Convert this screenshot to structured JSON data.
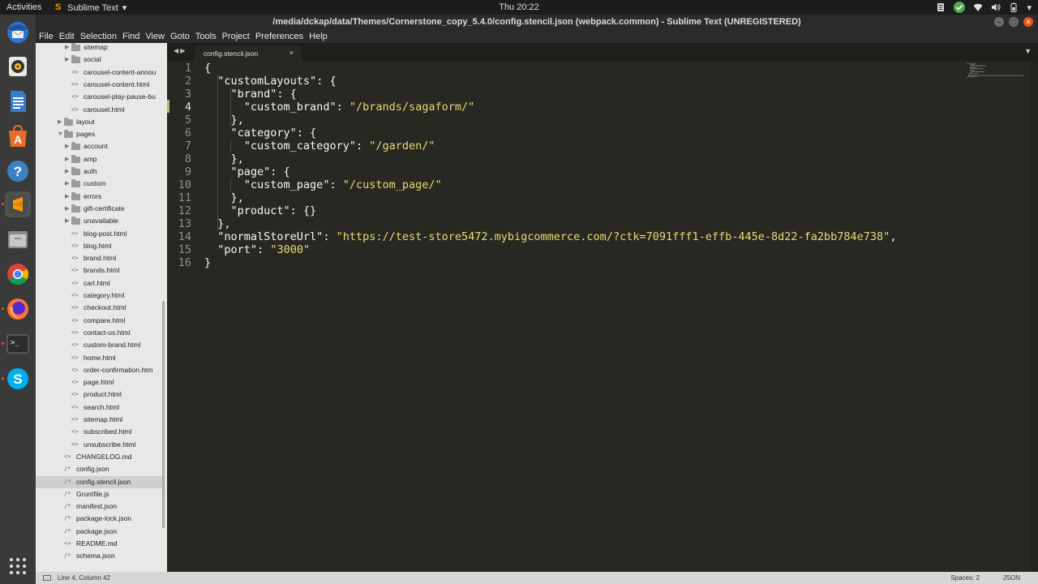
{
  "topbar": {
    "activities": "Activities",
    "app_name": "Sublime Text",
    "app_menu_arrow": "▾",
    "clock": "Thu 20:22"
  },
  "window": {
    "title": "/media/dckap/data/Themes/Cornerstone_copy_5.4.0/config.stencil.json (webpack.common) - Sublime Text (UNREGISTERED)"
  },
  "menu": [
    "File",
    "Edit",
    "Selection",
    "Find",
    "View",
    "Goto",
    "Tools",
    "Project",
    "Preferences",
    "Help"
  ],
  "dock": {
    "items": [
      "thunderbird-icon",
      "rhythmbox-icon",
      "writer-icon",
      "software-center-icon",
      "help-icon",
      "sublime-text-icon",
      "files-icon",
      "chrome-icon",
      "firefox-icon",
      "terminal-icon",
      "skype-icon"
    ],
    "show_apps": "show-applications-icon"
  },
  "sidebar": {
    "rows": [
      {
        "label": "sitemap",
        "kind": "folder",
        "depth": 2
      },
      {
        "label": "social",
        "kind": "folder",
        "depth": 2
      },
      {
        "label": "carousel-content-annou",
        "kind": "file",
        "depth": 2,
        "icon": "<>"
      },
      {
        "label": "carousel-content.html",
        "kind": "file",
        "depth": 2,
        "icon": "<>"
      },
      {
        "label": "carousel-play-pause-bu",
        "kind": "file",
        "depth": 2,
        "icon": "<>"
      },
      {
        "label": "carousel.html",
        "kind": "file",
        "depth": 2,
        "icon": "<>"
      },
      {
        "label": "layout",
        "kind": "folder",
        "depth": 1
      },
      {
        "label": "pages",
        "kind": "folder-open",
        "depth": 1
      },
      {
        "label": "account",
        "kind": "folder",
        "depth": 2
      },
      {
        "label": "amp",
        "kind": "folder",
        "depth": 2
      },
      {
        "label": "auth",
        "kind": "folder",
        "depth": 2
      },
      {
        "label": "custom",
        "kind": "folder",
        "depth": 2
      },
      {
        "label": "errors",
        "kind": "folder",
        "depth": 2
      },
      {
        "label": "gift-certificate",
        "kind": "folder",
        "depth": 2
      },
      {
        "label": "unavailable",
        "kind": "folder",
        "depth": 2
      },
      {
        "label": "blog-post.html",
        "kind": "file",
        "depth": 2,
        "icon": "<>"
      },
      {
        "label": "blog.html",
        "kind": "file",
        "depth": 2,
        "icon": "<>"
      },
      {
        "label": "brand.html",
        "kind": "file",
        "depth": 2,
        "icon": "<>"
      },
      {
        "label": "brands.html",
        "kind": "file",
        "depth": 2,
        "icon": "<>"
      },
      {
        "label": "cart.html",
        "kind": "file",
        "depth": 2,
        "icon": "<>"
      },
      {
        "label": "category.html",
        "kind": "file",
        "depth": 2,
        "icon": "<>"
      },
      {
        "label": "checkout.html",
        "kind": "file",
        "depth": 2,
        "icon": "<>"
      },
      {
        "label": "compare.html",
        "kind": "file",
        "depth": 2,
        "icon": "<>"
      },
      {
        "label": "contact-us.html",
        "kind": "file",
        "depth": 2,
        "icon": "<>"
      },
      {
        "label": "custom-brand.html",
        "kind": "file",
        "depth": 2,
        "icon": "<>"
      },
      {
        "label": "home.html",
        "kind": "file",
        "depth": 2,
        "icon": "<>"
      },
      {
        "label": "order-confirmation.htm",
        "kind": "file",
        "depth": 2,
        "icon": "<>"
      },
      {
        "label": "page.html",
        "kind": "file",
        "depth": 2,
        "icon": "<>"
      },
      {
        "label": "product.html",
        "kind": "file",
        "depth": 2,
        "icon": "<>"
      },
      {
        "label": "search.html",
        "kind": "file",
        "depth": 2,
        "icon": "<>"
      },
      {
        "label": "sitemap.html",
        "kind": "file",
        "depth": 2,
        "icon": "<>"
      },
      {
        "label": "subscribed.html",
        "kind": "file",
        "depth": 2,
        "icon": "<>"
      },
      {
        "label": "unsubscribe.html",
        "kind": "file",
        "depth": 2,
        "icon": "<>"
      },
      {
        "label": "CHANGELOG.md",
        "kind": "file",
        "depth": 1,
        "icon": "<>"
      },
      {
        "label": "config.json",
        "kind": "file",
        "depth": 1,
        "icon": "/*"
      },
      {
        "label": "config.stencil.json",
        "kind": "file",
        "depth": 1,
        "icon": "/*",
        "selected": true
      },
      {
        "label": "Gruntfile.js",
        "kind": "file",
        "depth": 1,
        "icon": "/*"
      },
      {
        "label": "manifest.json",
        "kind": "file",
        "depth": 1,
        "icon": "/*"
      },
      {
        "label": "package-lock.json",
        "kind": "file",
        "depth": 1,
        "icon": "/*"
      },
      {
        "label": "package.json",
        "kind": "file",
        "depth": 1,
        "icon": "/*"
      },
      {
        "label": "README.md",
        "kind": "file",
        "depth": 1,
        "icon": "<>"
      },
      {
        "label": "schema.json",
        "kind": "file",
        "depth": 1,
        "icon": "/*"
      }
    ]
  },
  "tabs": {
    "nav": "◀ ▶",
    "active_tab": "config.stencil.json",
    "close": "×",
    "menu": "▼"
  },
  "editor": {
    "current_line": 4,
    "lines": [
      [
        [
          "{",
          "p"
        ]
      ],
      [
        [
          "  ",
          "p"
        ],
        [
          "\"customLayouts\"",
          "k"
        ],
        [
          ": {",
          "p"
        ]
      ],
      [
        [
          "    ",
          "p"
        ],
        [
          "\"brand\"",
          "k"
        ],
        [
          ": {",
          "p"
        ]
      ],
      [
        [
          "      ",
          "p"
        ],
        [
          "\"custom_brand\"",
          "k"
        ],
        [
          ": ",
          "p"
        ],
        [
          "\"/brands/sagaform/\"",
          "s"
        ]
      ],
      [
        [
          "    },",
          "p"
        ]
      ],
      [
        [
          "    ",
          "p"
        ],
        [
          "\"category\"",
          "k"
        ],
        [
          ": {",
          "p"
        ]
      ],
      [
        [
          "      ",
          "p"
        ],
        [
          "\"custom_category\"",
          "k"
        ],
        [
          ": ",
          "p"
        ],
        [
          "\"/garden/\"",
          "s"
        ]
      ],
      [
        [
          "    },",
          "p"
        ]
      ],
      [
        [
          "    ",
          "p"
        ],
        [
          "\"page\"",
          "k"
        ],
        [
          ": {",
          "p"
        ]
      ],
      [
        [
          "      ",
          "p"
        ],
        [
          "\"custom_page\"",
          "k"
        ],
        [
          ": ",
          "p"
        ],
        [
          "\"/custom_page/\"",
          "s"
        ]
      ],
      [
        [
          "    },",
          "p"
        ]
      ],
      [
        [
          "    ",
          "p"
        ],
        [
          "\"product\"",
          "k"
        ],
        [
          ": {}",
          "p"
        ]
      ],
      [
        [
          "  },",
          "p"
        ]
      ],
      [
        [
          "  ",
          "p"
        ],
        [
          "\"normalStoreUrl\"",
          "k"
        ],
        [
          ": ",
          "p"
        ],
        [
          "\"https://test-store5472.mybigcommerce.com/?ctk=7091fff1-effb-445e-8d22-fa2bb784e738\"",
          "s"
        ],
        [
          ",",
          "p"
        ]
      ],
      [
        [
          "  ",
          "p"
        ],
        [
          "\"port\"",
          "k"
        ],
        [
          ": ",
          "p"
        ],
        [
          "\"3000\"",
          "s"
        ]
      ],
      [
        [
          "}",
          "p"
        ]
      ]
    ]
  },
  "statusbar": {
    "position": "Line 4, Column 42",
    "spaces": "Spaces: 2",
    "syntax": "JSON"
  }
}
